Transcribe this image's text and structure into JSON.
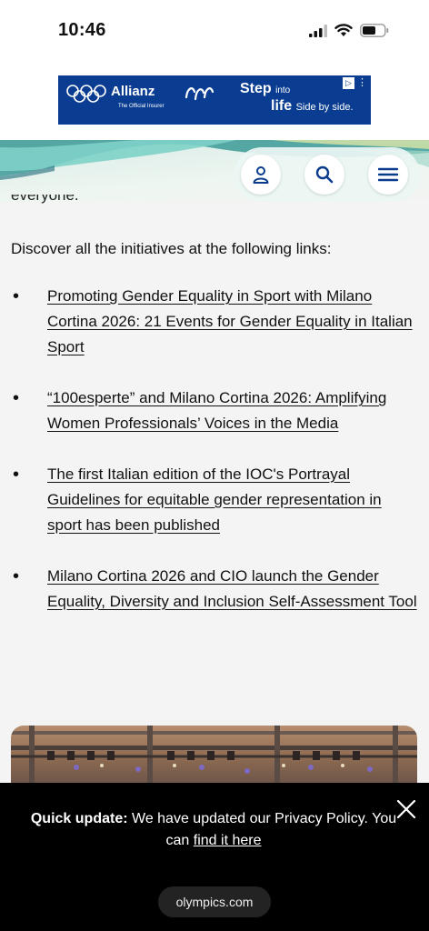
{
  "status_bar": {
    "time": "10:46"
  },
  "ad": {
    "brand": "Allianz",
    "brand_sub": "The Official Insurer",
    "headline_bold": "Step",
    "headline_small": "into",
    "headline2_bold": "life",
    "headline2_small": "Side by side.",
    "colors": {
      "background": "#0a3d91"
    }
  },
  "header": {
    "icons": [
      "user-icon",
      "search-icon",
      "menu-icon"
    ]
  },
  "content": {
    "clipped_text": "everyone.",
    "intro": "Discover all the initiatives at the following links:",
    "links": [
      {
        "text": "Promoting Gender Equality in Sport with Milano Cortina 2026: 21 Events for Gender Equality in Italian Sport"
      },
      {
        "text": "“100esperte” and Milano Cortina 2026: Amplifying Women Professionals’ Voices in the Media"
      },
      {
        "text": "The first Italian edition of the IOC's Portrayal Guidelines for equitable gender representation in sport has been published"
      },
      {
        "text": "Milano Cortina 2026 and CIO launch the Gender Equality, Diversity and Inclusion Self-Assessment Tool"
      }
    ]
  },
  "cookie_banner": {
    "label": "Quick update:",
    "message": "We have updated our Privacy Policy. You can",
    "link": "find it here"
  },
  "browser": {
    "url": "olympics.com"
  }
}
